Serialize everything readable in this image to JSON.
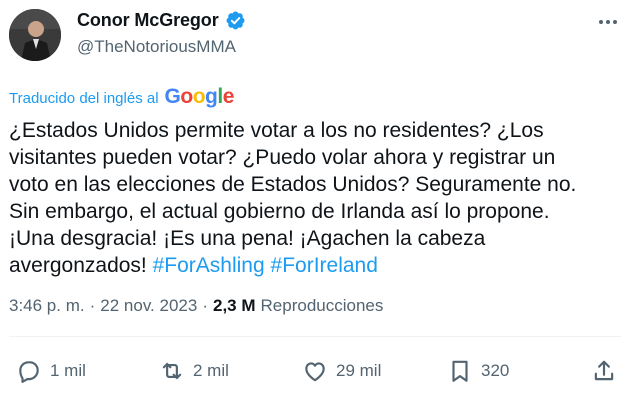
{
  "author": {
    "name": "Conor McGregor",
    "handle": "@TheNotoriousMMA",
    "verified_color": "#1d9bf0"
  },
  "translation": {
    "label": "Traducido del inglés al",
    "provider": "Google"
  },
  "tweet": {
    "lines": [
      "¿Estados Unidos permite votar a los no residentes? ¿Los",
      "visitantes pueden votar? ¿Puedo volar ahora y registrar un",
      "voto en las elecciones de Estados Unidos? Seguramente no.",
      "Sin embargo, el actual gobierno de Irlanda así lo propone.",
      "¡Una desgracia! ¡Es una pena! ¡Agachen la cabeza"
    ],
    "last_line_text": "avergonzados!",
    "hashtags": [
      "#ForAshling",
      "#ForIreland"
    ]
  },
  "meta": {
    "time": "3:46 p. m.",
    "separator": "·",
    "date": "22 nov. 2023",
    "views_count": "2,3 M",
    "views_label": "Reproducciones"
  },
  "actions": {
    "replies": "1 mil",
    "retweets": "2 mil",
    "likes": "29 mil",
    "bookmarks": "320"
  },
  "icons": [
    "more-icon",
    "verified-icon",
    "reply-icon",
    "retweet-icon",
    "like-icon",
    "bookmark-icon",
    "share-icon"
  ],
  "colors": {
    "accent": "#1d9bf0",
    "text": "#0f1419",
    "muted": "#536471"
  }
}
